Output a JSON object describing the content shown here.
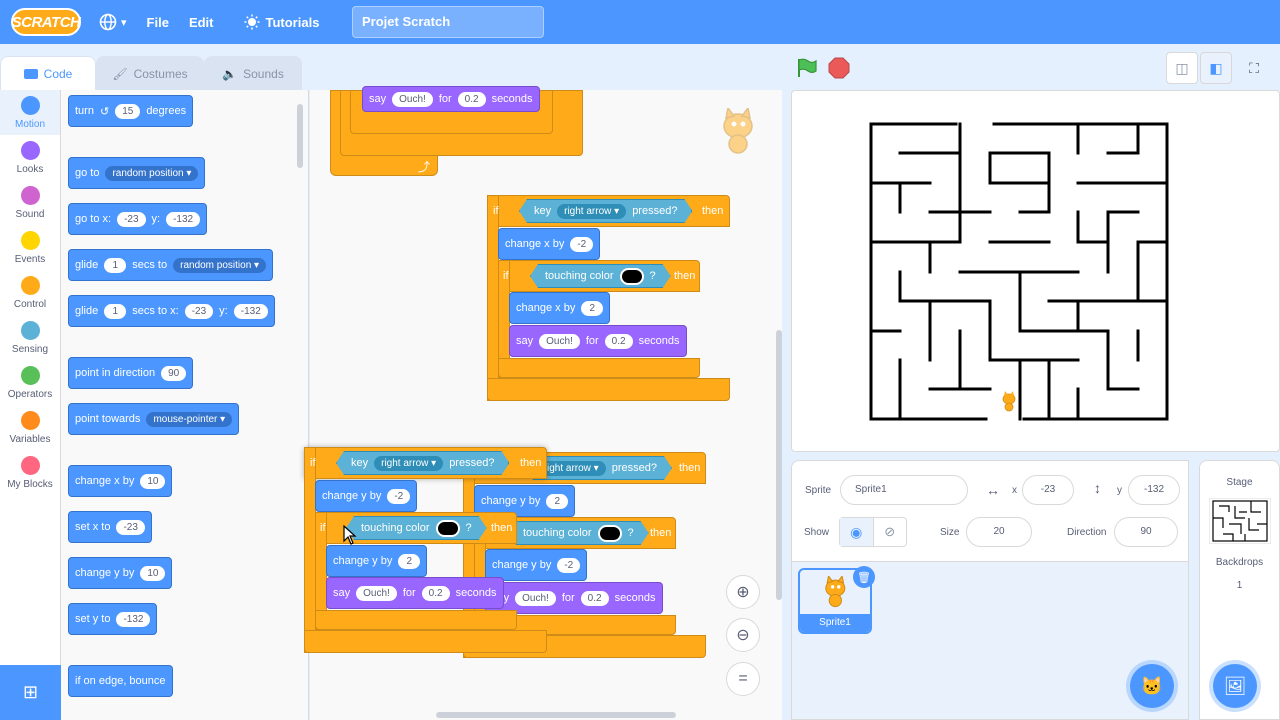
{
  "menubar": {
    "logo": "SCRATCH",
    "file": "File",
    "edit": "Edit",
    "tutorials": "Tutorials",
    "project_title": "Projet Scratch"
  },
  "tabs": {
    "code": "Code",
    "costumes": "Costumes",
    "sounds": "Sounds"
  },
  "categories": [
    {
      "label": "Motion",
      "color": "#4c97ff"
    },
    {
      "label": "Looks",
      "color": "#9966ff"
    },
    {
      "label": "Sound",
      "color": "#cf63cf"
    },
    {
      "label": "Events",
      "color": "#ffd500"
    },
    {
      "label": "Control",
      "color": "#ffab19"
    },
    {
      "label": "Sensing",
      "color": "#5cb1d6"
    },
    {
      "label": "Operators",
      "color": "#59c059"
    },
    {
      "label": "Variables",
      "color": "#ff8c1a"
    },
    {
      "label": "My Blocks",
      "color": "#ff6680"
    }
  ],
  "palette": {
    "turn": "turn",
    "turn_val": "15",
    "degrees": "degrees",
    "goto": "go to",
    "goto_dd": "random position",
    "gotoxy": "go to x:",
    "gotoxy_x": "-23",
    "y_label": "y:",
    "gotoxy_y": "-132",
    "glide": "glide",
    "glide_val": "1",
    "secs_to": "secs to",
    "glide_dd": "random position",
    "glide2_val": "1",
    "secs_to_x": "secs to x:",
    "glide2_x": "-23",
    "glide2_y": "-132",
    "point_dir": "point in direction",
    "point_dir_val": "90",
    "point_towards": "point towards",
    "point_towards_dd": "mouse-pointer",
    "change_x": "change x by",
    "change_x_val": "10",
    "set_x": "set x to",
    "set_x_val": "-23",
    "change_y": "change y by",
    "change_y_val": "10",
    "set_y": "set y to",
    "set_y_val": "-132",
    "bounce": "if on edge, bounce"
  },
  "script": {
    "say": "say",
    "ouch": "Ouch!",
    "for": "for",
    "secs": "0.2",
    "seconds": "seconds",
    "if": "if",
    "then": "then",
    "key": "key",
    "right_arrow": "right arrow",
    "pressed": "pressed?",
    "change_x_by": "change x by",
    "change_y_by": "change y by",
    "minus2": "-2",
    "plus2": "2",
    "touching_color": "touching color",
    "q": "?",
    "ight_arrow": "ight arrow"
  },
  "sprite": {
    "sprite_label": "Sprite",
    "sprite_name": "Sprite1",
    "x_label": "x",
    "x_val": "-23",
    "y_label": "y",
    "y_val": "-132",
    "show_label": "Show",
    "size_label": "Size",
    "size_val": "20",
    "direction_label": "Direction",
    "direction_val": "90",
    "tile_name": "Sprite1"
  },
  "stage_panel": {
    "title": "Stage",
    "backdrops_label": "Backdrops",
    "backdrops_count": "1"
  }
}
